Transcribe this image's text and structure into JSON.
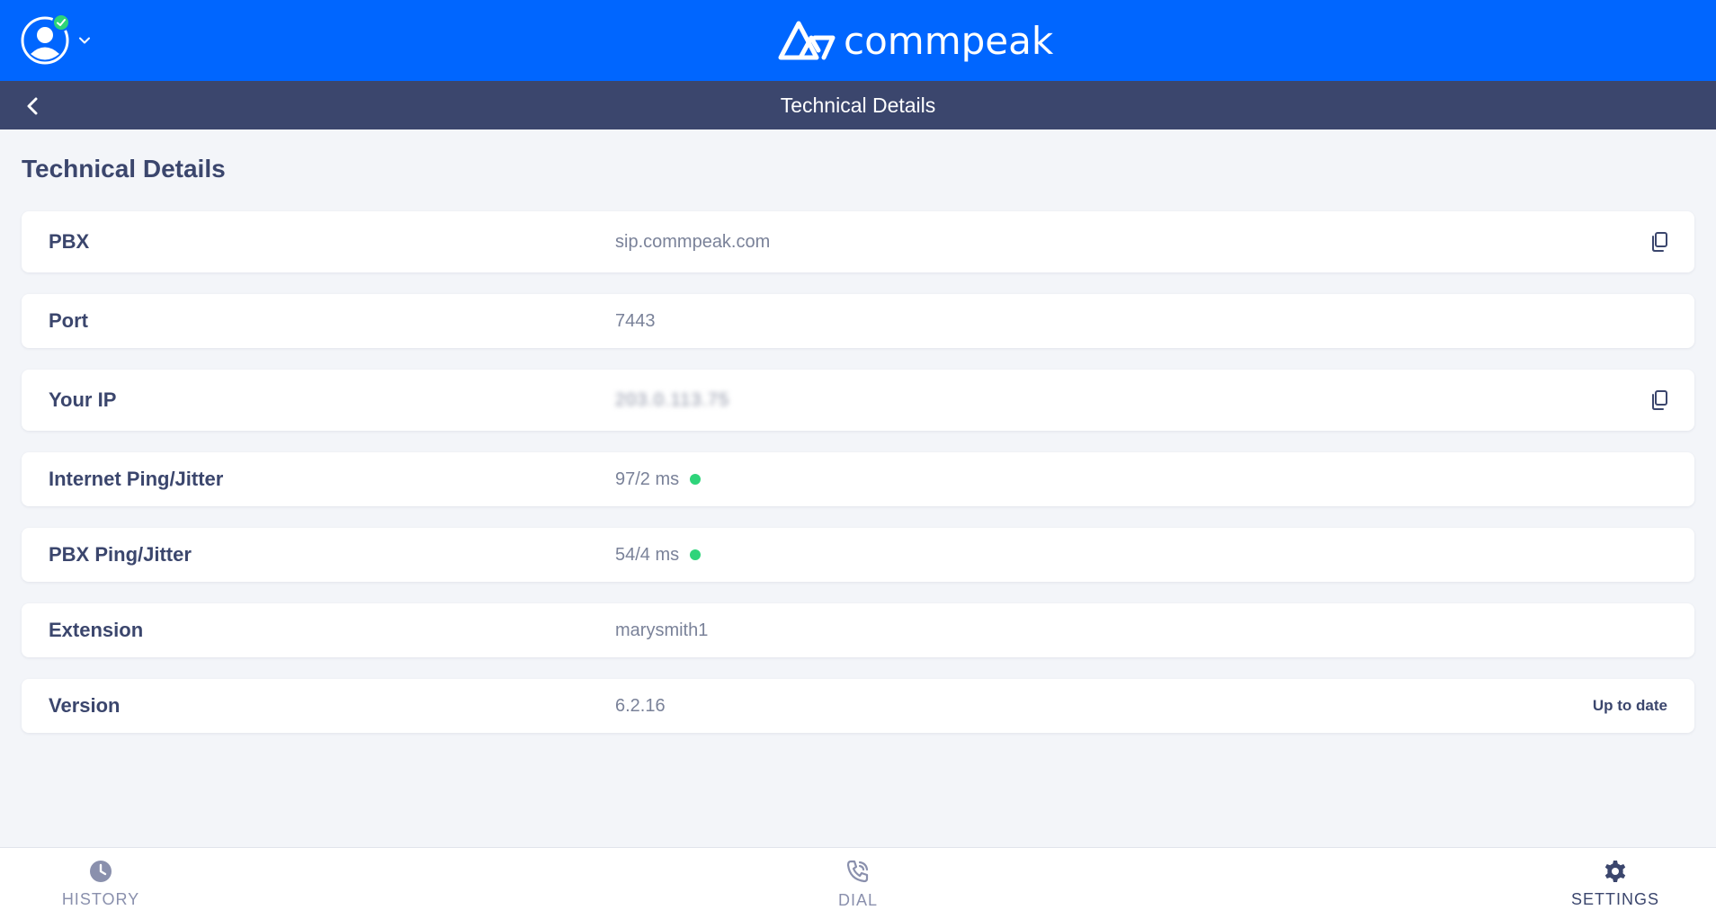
{
  "brand": {
    "name": "commpeak",
    "primary_color": "#0066ff",
    "nav_color": "#3b466d",
    "status_ok_color": "#2ed47a"
  },
  "header": {
    "user_icon": "user-avatar-icon",
    "status_icon": "check-icon",
    "menu_icon": "chevron-down-icon"
  },
  "navbar": {
    "back_icon": "chevron-left-icon",
    "title": "Technical Details"
  },
  "main": {
    "title": "Technical Details",
    "rows": [
      {
        "label": "PBX",
        "value": "sip.commpeak.com",
        "action_icon": "copy-icon"
      },
      {
        "label": "Port",
        "value": "7443"
      },
      {
        "label": "Your IP",
        "value": "203.0.113.75",
        "action_icon": "copy-icon"
      },
      {
        "label": "Internet Ping/Jitter",
        "value": "97/2 ms",
        "status": "good"
      },
      {
        "label": "PBX Ping/Jitter",
        "value": "54/4 ms",
        "status": "good"
      },
      {
        "label": "Extension",
        "value": "marysmith1"
      },
      {
        "label": "Version",
        "value": "6.2.16",
        "status_text": "Up to date"
      }
    ]
  },
  "bottom_nav": {
    "tabs": [
      {
        "label": "HISTORY",
        "icon": "clock-icon"
      },
      {
        "label": "DIAL",
        "icon": "phone-icon"
      },
      {
        "label": "SETTINGS",
        "icon": "gear-icon",
        "active": true
      }
    ]
  }
}
